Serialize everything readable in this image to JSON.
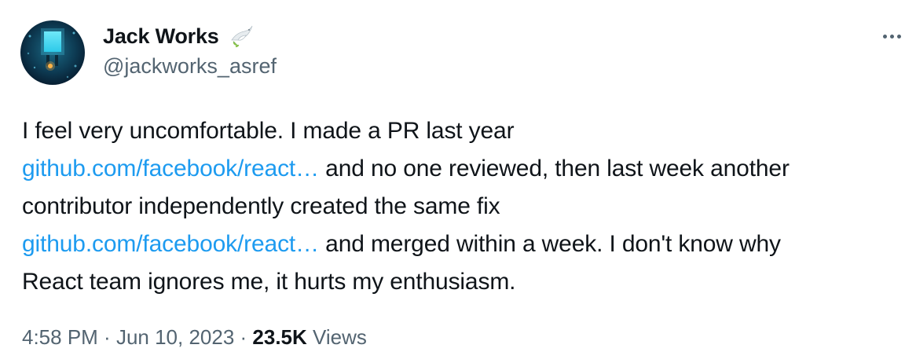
{
  "author": {
    "name": "Jack Works",
    "handle": "@jackworks_asref",
    "badge_icon": "dove-icon",
    "avatar_icon": "avatar-image"
  },
  "more_button": {
    "icon": "more-horizontal-icon"
  },
  "tweet": {
    "line1": "I feel very uncomfortable. I made a PR last year",
    "link1": "github.com/facebook/react…",
    "after_link1": " and no one reviewed, then last week another",
    "line3": "contributor independently created the same fix",
    "link2": "github.com/facebook/react…",
    "after_link2": " and merged within a week. I don't know why",
    "line5": "React team ignores me, it hurts my enthusiasm."
  },
  "meta": {
    "time": "4:58 PM",
    "separator1": " · ",
    "date": "Jun 10, 2023",
    "separator2": " · ",
    "views_count": "23.5K",
    "views_label": " Views"
  },
  "colors": {
    "link": "#1d9bf0",
    "secondary_text": "#536471",
    "primary_text": "#0f1419"
  }
}
